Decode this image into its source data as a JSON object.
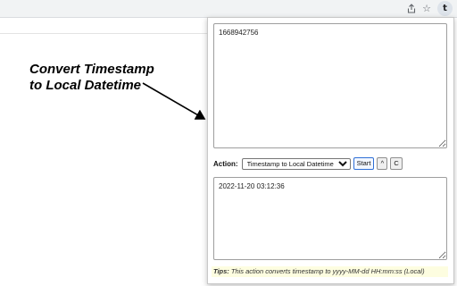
{
  "browser": {
    "share_icon": "share-icon",
    "star_icon": "star-icon",
    "extension_icon": "t"
  },
  "annotation": {
    "line1": "Convert Timestamp",
    "line2": "to Local Datetime"
  },
  "popup": {
    "input_value": "1668942756",
    "action_label": "Action:",
    "action_selected": "Timestamp to Local Datetime",
    "start_label": "Start",
    "caret_label": "^",
    "clear_label": "C",
    "output_value": "2022-11-20 03:12:36",
    "tips_label": "Tips:",
    "tips_text": "This action converts timestamp to yyyy-MM-dd HH:mm:ss (Local)"
  },
  "colors": {
    "start_button_border": "#2f6fd6",
    "tips_background": "#fdfde0"
  }
}
